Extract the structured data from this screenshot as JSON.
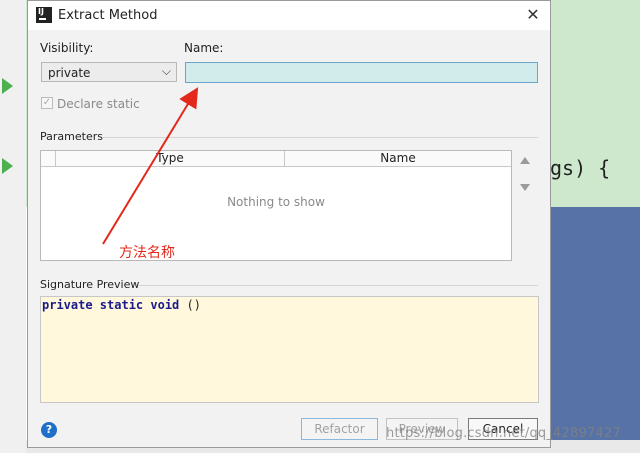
{
  "dialog": {
    "title": "Extract Method",
    "app_icon": "intellij-icon",
    "close_glyph": "✕"
  },
  "visibility": {
    "label": "Visibility:",
    "selected": "private"
  },
  "name": {
    "label": "Name:",
    "value": ""
  },
  "declare_static": {
    "label": "Declare static",
    "checked": true,
    "enabled": false
  },
  "parameters": {
    "label": "Parameters",
    "columns": [
      "Type",
      "Name"
    ],
    "empty_text": "Nothing to show"
  },
  "signature_preview": {
    "label": "Signature Preview",
    "keywords": "private static void",
    "rest": " ()"
  },
  "buttons": {
    "refactor": "Refactor",
    "preview": "Preview",
    "cancel": "Cancel",
    "help": "?"
  },
  "background": {
    "code_fragment": "gs) {"
  },
  "annotation": {
    "text": "方法名称",
    "color": "#e2291c"
  },
  "watermark": "https://blog.csdn.net/qq_42897427",
  "colors": {
    "name_field_bg": "#d2ecec",
    "preview_bg": "#fff8dc",
    "editor_bg": "#cde8cd",
    "accent_blue": "#5672a6"
  }
}
